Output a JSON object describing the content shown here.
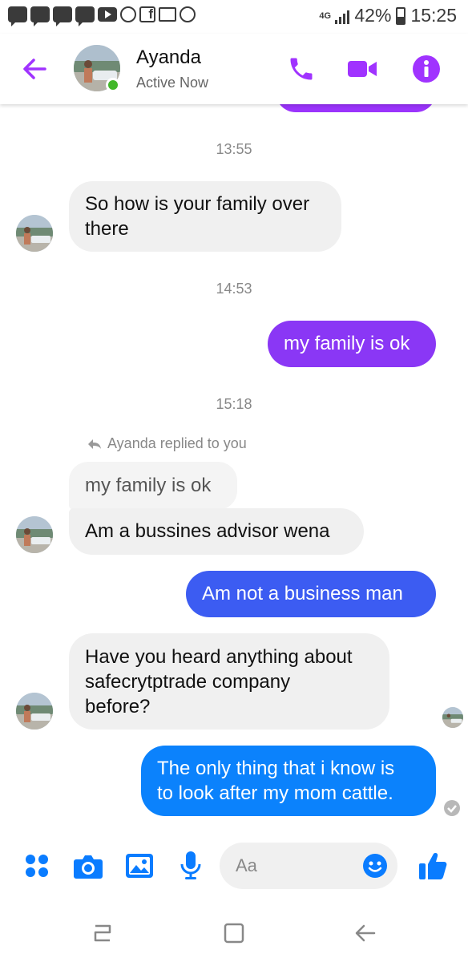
{
  "status_bar": {
    "network": "4G",
    "battery": "42%",
    "time": "15:25"
  },
  "header": {
    "contact_name": "Ayanda",
    "contact_status": "Active Now",
    "accent_color": "#a033ff",
    "icons": [
      "back-arrow-icon",
      "phone-icon",
      "video-camera-icon",
      "info-icon"
    ]
  },
  "messages": [
    {
      "type": "outgoing-partial",
      "color": "#9b34fc"
    },
    {
      "type": "timestamp",
      "text": "13:55"
    },
    {
      "type": "incoming",
      "lines": [
        "So how is your family over",
        "there"
      ]
    },
    {
      "type": "timestamp",
      "text": "14:53"
    },
    {
      "type": "outgoing",
      "text": "my family is ok",
      "color": "#8a37f5"
    },
    {
      "type": "timestamp",
      "text": "15:18"
    },
    {
      "type": "reply-note",
      "text": "Ayanda replied to you"
    },
    {
      "type": "quoted",
      "text": "my family is ok"
    },
    {
      "type": "incoming",
      "text": "Am a bussines advisor wena"
    },
    {
      "type": "outgoing",
      "text": "Am not a business man",
      "color": "#3c5cf2"
    },
    {
      "type": "incoming",
      "lines": [
        "Have you heard anything about",
        "safecrytptrade company",
        "before?"
      ]
    },
    {
      "type": "outgoing",
      "lines": [
        "The only thing that i know is",
        "to look after my mom cattle."
      ],
      "color": "#0b82fc"
    }
  ],
  "composer": {
    "placeholder": "Aa",
    "accent_color": "#0a7cff",
    "icons": [
      "more-dots-icon",
      "camera-icon",
      "gallery-icon",
      "microphone-icon",
      "emoji-icon",
      "like-thumb-icon"
    ]
  },
  "nav_bar": {
    "icons": [
      "recent-apps-icon",
      "home-icon",
      "back-icon"
    ]
  }
}
